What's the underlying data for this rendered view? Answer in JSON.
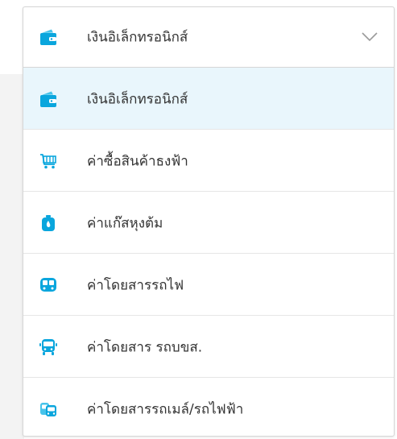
{
  "colors": {
    "accent": "#0aa6dd",
    "selected_bg": "#e9f6fc",
    "text": "#333333",
    "border": "#d6d6d6"
  },
  "select": {
    "value": "เงินอิเล็กทรอนิกส์",
    "icon": "wallet-icon"
  },
  "options": [
    {
      "label": "เงินอิเล็กทรอนิกส์",
      "icon": "wallet-icon",
      "selected": true
    },
    {
      "label": "ค่าซื้อสินค้าธงฟ้า",
      "icon": "shopping-cart-icon",
      "selected": false
    },
    {
      "label": "ค่าแก๊สหุงต้ม",
      "icon": "gas-cylinder-icon",
      "selected": false
    },
    {
      "label": "ค่าโดยสารรถไฟ",
      "icon": "train-icon",
      "selected": false
    },
    {
      "label": "ค่าโดยสาร รถบขส.",
      "icon": "bus-icon",
      "selected": false
    },
    {
      "label": "ค่าโดยสารรถเมล์/รถไฟฟ้า",
      "icon": "skytrain-icon",
      "selected": false
    }
  ]
}
